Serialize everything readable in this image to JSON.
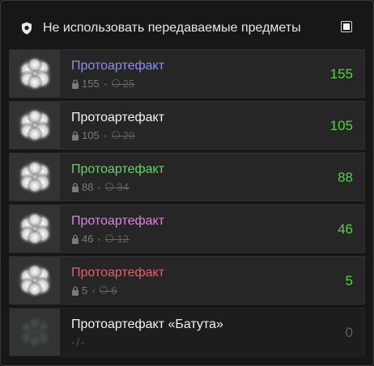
{
  "header": {
    "label": "Не использовать передаваемые предметы",
    "checkbox_checked": true,
    "icon": "shield-icon"
  },
  "items": [
    {
      "name": "Протоартефакт",
      "name_color": "#8c8cf0",
      "locked": "155",
      "tradable": "25",
      "count": "155"
    },
    {
      "name": "Протоартефакт",
      "name_color": "#f2f2f2",
      "locked": "105",
      "tradable": "20",
      "count": "105"
    },
    {
      "name": "Протоартефакт",
      "name_color": "#5fd75f",
      "locked": "88",
      "tradable": "34",
      "count": "88"
    },
    {
      "name": "Протоартефакт",
      "name_color": "#e27fe8",
      "locked": "46",
      "tradable": "12",
      "count": "46"
    },
    {
      "name": "Протоартефакт",
      "name_color": "#f05a6a",
      "locked": "5",
      "tradable": "6",
      "count": "5"
    },
    {
      "name": "Протоартефакт «Батута»",
      "name_color": "#f2f2f2",
      "meta": "-/-",
      "count": "0"
    }
  ],
  "colors": {
    "count_positive": "#5fcc4f",
    "count_zero": "#5e5e5e"
  }
}
